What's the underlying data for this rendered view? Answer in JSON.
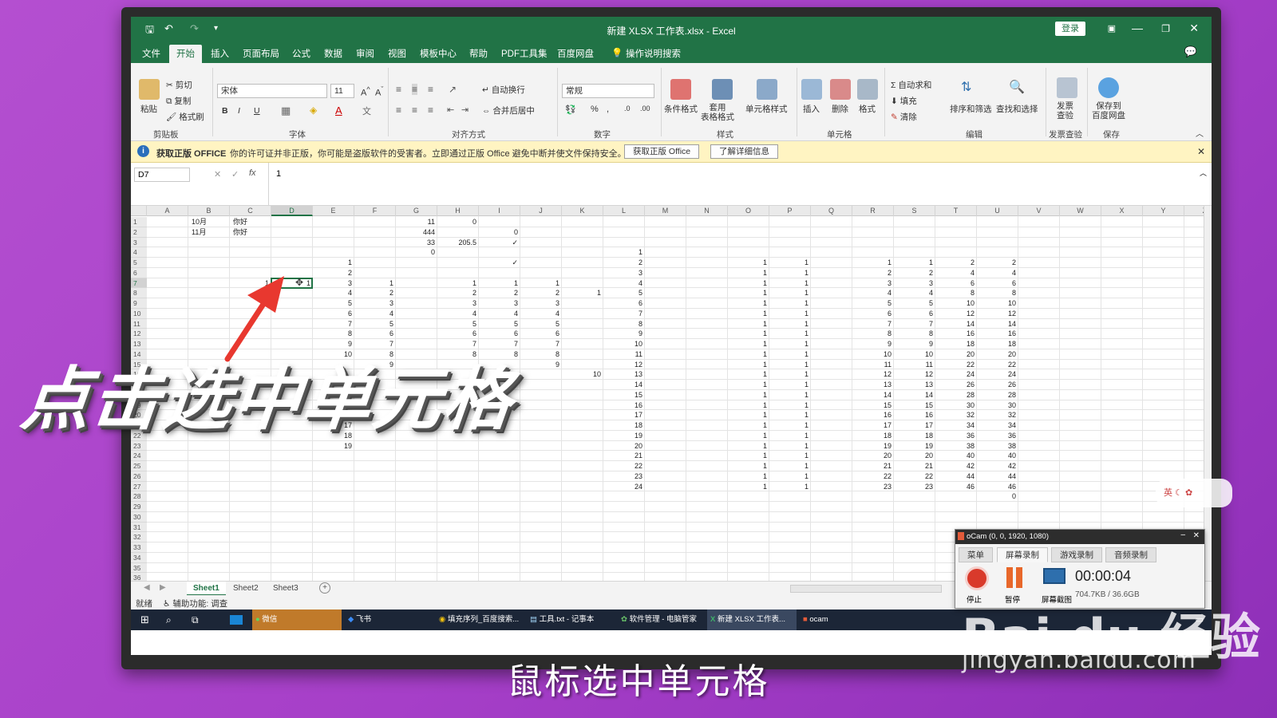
{
  "window": {
    "title": "新建 XLSX 工作表.xlsx - Excel",
    "login": "登录"
  },
  "menu": [
    "文件",
    "开始",
    "插入",
    "页面布局",
    "公式",
    "数据",
    "审阅",
    "视图",
    "模板中心",
    "帮助",
    "PDF工具集",
    "百度网盘",
    "操作说明搜索"
  ],
  "ribbon": {
    "clipboard": {
      "paste": "粘贴",
      "cut": "剪切",
      "copy": "复制",
      "format_painter": "格式刷",
      "label": "剪贴板"
    },
    "font": {
      "name": "宋体",
      "size": "11",
      "bold": "B",
      "italic": "I",
      "underline": "U",
      "label": "字体"
    },
    "alignment": {
      "wrap": "自动换行",
      "merge": "合并后居中",
      "label": "对齐方式"
    },
    "number": {
      "format": "常规",
      "label": "数字"
    },
    "styles": {
      "conditional": "条件格式",
      "table": "套用\n表格格式",
      "cell_styles": "单元格样式",
      "label": "样式"
    },
    "cells": {
      "insert": "插入",
      "delete": "删除",
      "format": "格式",
      "label": "单元格"
    },
    "editing": {
      "autosum": "自动求和",
      "fill": "填充",
      "clear": "清除",
      "sort": "排序和筛选",
      "find": "查找和选择",
      "label": "编辑"
    },
    "invoice": {
      "check": "发票\n查验",
      "label": "发票查验"
    },
    "save": {
      "save_to": "保存到\n百度网盘",
      "label": "保存"
    }
  },
  "warning": {
    "title": "获取正版 OFFICE",
    "message": "你的许可证并非正版，你可能是盗版软件的受害者。立即通过正版 Office 避免中断并使文件保持安全。",
    "btn_get": "获取正版 Office",
    "btn_more": "了解详细信息"
  },
  "formula": {
    "namebox": "D7",
    "fx": "fx",
    "value": "1"
  },
  "columns": [
    "A",
    "B",
    "C",
    "D",
    "E",
    "F",
    "G",
    "H",
    "I",
    "J",
    "K",
    "L",
    "M",
    "N",
    "O",
    "P",
    "Q",
    "R",
    "S",
    "T",
    "U",
    "V",
    "W",
    "X",
    "Y",
    "Z"
  ],
  "rows": [
    "1",
    "2",
    "3",
    "4",
    "5",
    "6",
    "7",
    "8",
    "9",
    "10",
    "11",
    "12",
    "13",
    "14",
    "15",
    "16",
    "17",
    "18",
    "19",
    "20",
    "21",
    "22",
    "23",
    "24",
    "25",
    "26",
    "27",
    "28",
    "29",
    "30",
    "31",
    "32",
    "33",
    "34",
    "35",
    "36"
  ],
  "cells": {
    "B1": "10月",
    "C1": "你好",
    "G1": "11",
    "H1": "0",
    "B2": "11月",
    "C2": "你好",
    "G2": "444",
    "I2": "0",
    "G3": "33",
    "H3": "205.5",
    "I3": "✓",
    "G4": "0",
    "L4": "1",
    "E5": "1",
    "I5": "✓",
    "L5": "2",
    "O5": "1",
    "P5": "1",
    "R5": "1",
    "S5": "1",
    "T5": "2",
    "U5": "2",
    "E6": "2",
    "L6": "3",
    "O6": "1",
    "P6": "1",
    "R6": "2",
    "S6": "2",
    "T6": "4",
    "U6": "4",
    "C7": "1",
    "D7": "1",
    "E7": "3",
    "F7": "1",
    "H7": "1",
    "I7": "1",
    "J7": "1",
    "L7": "4",
    "O7": "1",
    "P7": "1",
    "R7": "3",
    "S7": "3",
    "T7": "6",
    "U7": "6",
    "E8": "4",
    "F8": "2",
    "H8": "2",
    "I8": "2",
    "J8": "2",
    "K8": "1",
    "L8": "5",
    "O8": "1",
    "P8": "1",
    "R8": "4",
    "S8": "4",
    "T8": "8",
    "U8": "8",
    "E9": "5",
    "F9": "3",
    "H9": "3",
    "I9": "3",
    "J9": "3",
    "L9": "6",
    "O9": "1",
    "P9": "1",
    "R9": "5",
    "S9": "5",
    "T9": "10",
    "U9": "10",
    "E10": "6",
    "F10": "4",
    "H10": "4",
    "I10": "4",
    "J10": "4",
    "L10": "7",
    "O10": "1",
    "P10": "1",
    "R10": "6",
    "S10": "6",
    "T10": "12",
    "U10": "12",
    "E11": "7",
    "F11": "5",
    "H11": "5",
    "I11": "5",
    "J11": "5",
    "L11": "8",
    "O11": "1",
    "P11": "1",
    "R11": "7",
    "S11": "7",
    "T11": "14",
    "U11": "14",
    "E12": "8",
    "F12": "6",
    "H12": "6",
    "I12": "6",
    "J12": "6",
    "L12": "9",
    "O12": "1",
    "P12": "1",
    "R12": "8",
    "S12": "8",
    "T12": "16",
    "U12": "16",
    "E13": "9",
    "F13": "7",
    "H13": "7",
    "I13": "7",
    "J13": "7",
    "L13": "10",
    "O13": "1",
    "P13": "1",
    "R13": "9",
    "S13": "9",
    "T13": "18",
    "U13": "18",
    "E14": "10",
    "F14": "8",
    "H14": "8",
    "I14": "8",
    "J14": "8",
    "L14": "11",
    "O14": "1",
    "P14": "1",
    "R14": "10",
    "S14": "10",
    "T14": "20",
    "U14": "20",
    "F15": "9",
    "J15": "9",
    "L15": "12",
    "O15": "1",
    "P15": "1",
    "R15": "11",
    "S15": "11",
    "T15": "22",
    "U15": "22",
    "K16": "10",
    "L16": "13",
    "O16": "1",
    "P16": "1",
    "R16": "12",
    "S16": "12",
    "T16": "24",
    "U16": "24",
    "L17": "14",
    "O17": "1",
    "P17": "1",
    "R17": "13",
    "S17": "13",
    "T17": "26",
    "U17": "26",
    "L18": "15",
    "O18": "1",
    "P18": "1",
    "R18": "14",
    "S18": "14",
    "T18": "28",
    "U18": "28",
    "L19": "16",
    "O19": "1",
    "P19": "1",
    "R19": "15",
    "S19": "15",
    "T19": "30",
    "U19": "30",
    "L20": "17",
    "O20": "1",
    "P20": "1",
    "R20": "16",
    "S20": "16",
    "T20": "32",
    "U20": "32",
    "E21": "17",
    "L21": "18",
    "O21": "1",
    "P21": "1",
    "R21": "17",
    "S21": "17",
    "T21": "34",
    "U21": "34",
    "E22": "18",
    "L22": "19",
    "O22": "1",
    "P22": "1",
    "R22": "18",
    "S22": "18",
    "T22": "36",
    "U22": "36",
    "E23": "19",
    "L23": "20",
    "O23": "1",
    "P23": "1",
    "R23": "19",
    "S23": "19",
    "T23": "38",
    "U23": "38",
    "L24": "21",
    "O24": "1",
    "P24": "1",
    "R24": "20",
    "S24": "20",
    "T24": "40",
    "U24": "40",
    "L25": "22",
    "O25": "1",
    "P25": "1",
    "R25": "21",
    "S25": "21",
    "T25": "42",
    "U25": "42",
    "L26": "23",
    "O26": "1",
    "P26": "1",
    "R26": "22",
    "S26": "22",
    "T26": "44",
    "U26": "44",
    "L27": "24",
    "O27": "1",
    "P27": "1",
    "R27": "23",
    "S27": "23",
    "T27": "46",
    "U27": "46",
    "U28": "0"
  },
  "sheets": [
    "Sheet1",
    "Sheet2",
    "Sheet3"
  ],
  "status": {
    "ready": "就绪",
    "accessibility": "辅助功能: 调查"
  },
  "taskbar": [
    {
      "label": "微信",
      "icon": "wechat-icon"
    },
    {
      "label": "飞书",
      "icon": "feishu-icon"
    },
    {
      "label": "填充序列_百度搜索...",
      "icon": "chrome-icon"
    },
    {
      "label": "工具.txt - 记事本",
      "icon": "notepad-icon"
    },
    {
      "label": "软件管理 - 电脑管家",
      "icon": "pcmanager-icon"
    },
    {
      "label": "新建 XLSX 工作表...",
      "icon": "excel-icon"
    },
    {
      "label": "ocam",
      "icon": "ocam-icon"
    }
  ],
  "ocam": {
    "title": "oCam (0, 0, 1920, 1080)",
    "tabs": [
      "菜单",
      "屏幕录制",
      "游戏录制",
      "音频录制"
    ],
    "stop": "停止",
    "pause": "暂停",
    "capture": "屏幕截图",
    "time": "00:00:04",
    "size": "704.7KB / 36.6GB"
  },
  "overlay": {
    "title": "点击选中单元格",
    "caption": "鼠标选中单元格"
  },
  "watermark": {
    "brand": "Bai du 经验",
    "url": "jingyan.baidu.com"
  },
  "colors": {
    "excel_green": "#217346",
    "warning_bg": "#fff4c2",
    "arrow": "#e8382f",
    "selection": "#217346"
  }
}
